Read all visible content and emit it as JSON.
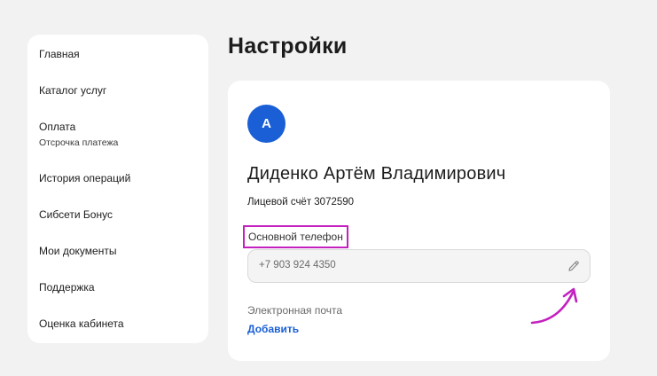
{
  "sidebar": {
    "items": [
      {
        "label": "Главная"
      },
      {
        "label": "Каталог услуг"
      },
      {
        "label": "Оплата",
        "sub": "Отсрочка платежа"
      },
      {
        "label": "История операций"
      },
      {
        "label": "Сибсети Бонус"
      },
      {
        "label": "Мои документы"
      },
      {
        "label": "Поддержка"
      },
      {
        "label": "Оценка кабинета"
      }
    ]
  },
  "page": {
    "title": "Настройки"
  },
  "profile": {
    "avatar_letter": "А",
    "full_name": "Диденко Артём Владимирович",
    "account": "Лицевой счёт 3072590",
    "phone_label": "Основной телефон",
    "phone_value": "+7 903 924 4350",
    "email_label": "Электронная почта",
    "email_add": "Добавить"
  },
  "icons": {
    "edit": "pencil-icon",
    "annotation": "curved-arrow-icon"
  },
  "colors": {
    "accent": "#1a5fd6",
    "highlight": "#c41fbf",
    "background": "#f2f2f2",
    "card": "#ffffff"
  }
}
